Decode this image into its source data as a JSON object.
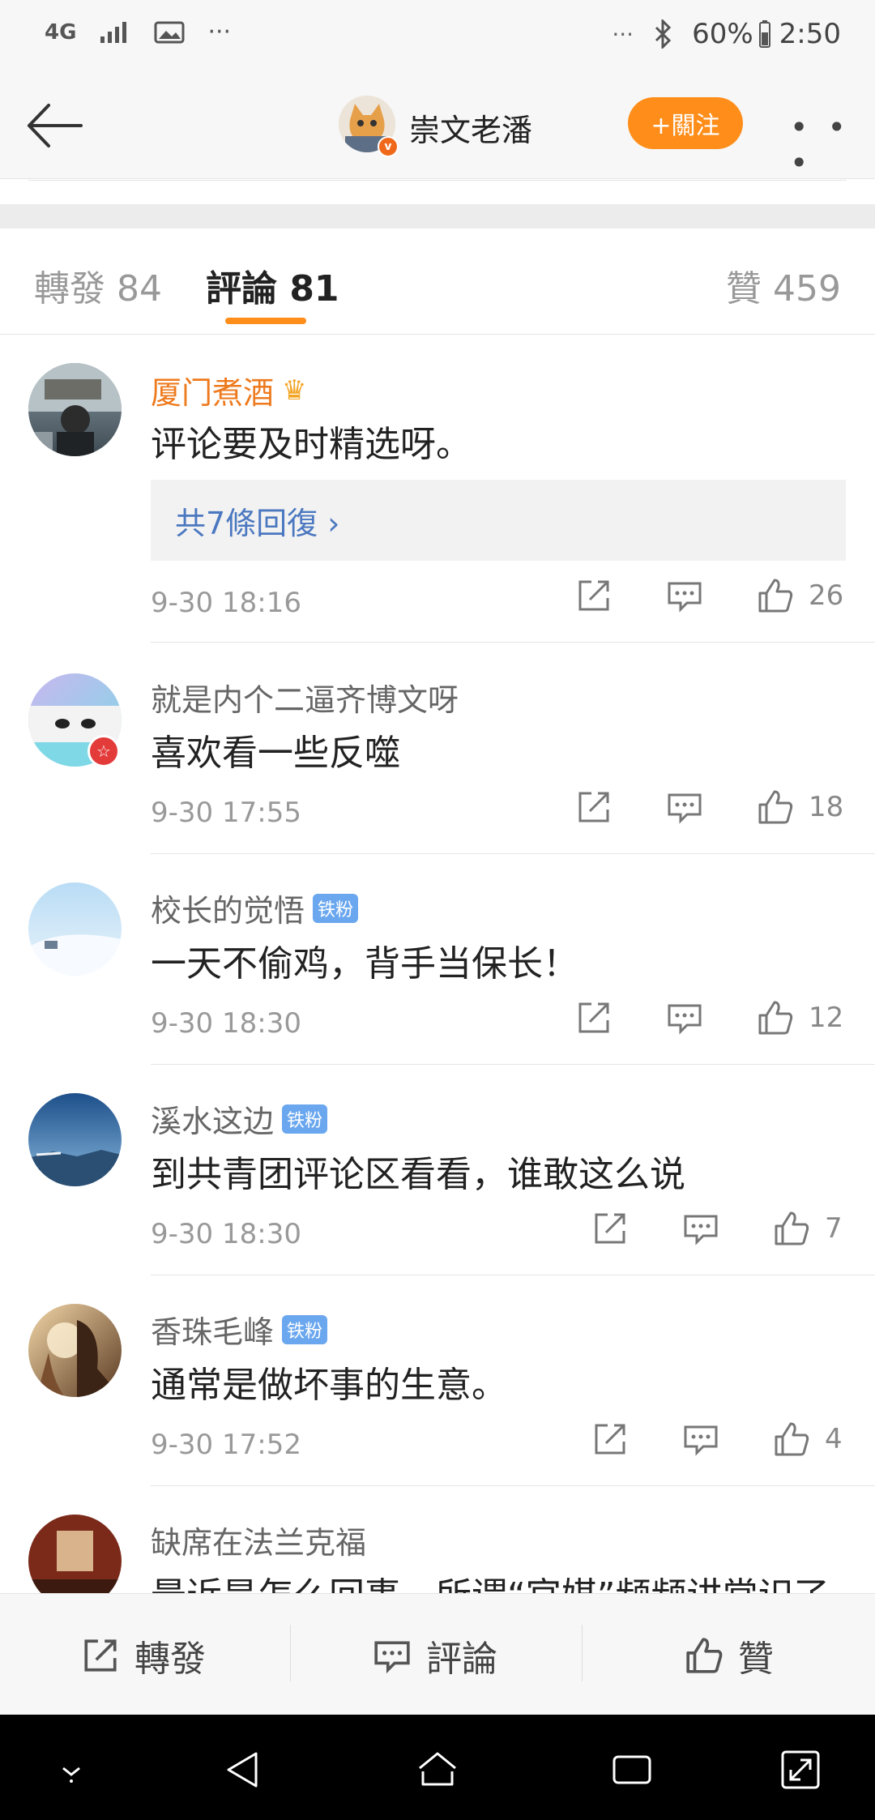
{
  "status_bar": {
    "left_items": [
      "4G",
      "signal",
      "image",
      "···"
    ],
    "right_text": "60%",
    "time": "2:50",
    "dots": "···"
  },
  "header": {
    "username": "崇文老潘",
    "follow_label": "+關注",
    "more": "• • •"
  },
  "tabs": {
    "reposts": "轉發 84",
    "comments": "評論 81",
    "likes": "贊 459"
  },
  "comments": [
    {
      "name": "厦门煮酒",
      "text": "评论要及时精选呀。",
      "replies": "共7條回復 ›",
      "date": "9-30 18:16",
      "likes": "26"
    },
    {
      "name": "就是内个二逼齐博文呀",
      "text": "喜欢看一些反噬",
      "date": "9-30 17:55",
      "likes": "18"
    },
    {
      "name": "校长的觉悟",
      "badge": "铁粉",
      "text": "一天不偷鸡，背手当保长！",
      "date": "9-30 18:30",
      "likes": "12"
    },
    {
      "name": "溪水这边",
      "badge": "铁粉",
      "text": "到共青团评论区看看，谁敢这么说",
      "date": "9-30 18:30",
      "likes": "7"
    },
    {
      "name": "香珠毛峰",
      "badge": "铁粉",
      "text": "通常是做坏事的生意。",
      "date": "9-30 17:52",
      "likes": "4"
    },
    {
      "name": "缺席在法兰克福",
      "text": "最近是怎么回事，所谓“官媒”频频讲常识了"
    }
  ],
  "bottom_bar": {
    "repost": "轉發",
    "comment": "評論",
    "like": "贊"
  },
  "colors": {
    "accent": "#ff8d1a",
    "link": "#4b78c0",
    "vip_name": "#ee7a1e",
    "badge": "#6aa7ef"
  }
}
